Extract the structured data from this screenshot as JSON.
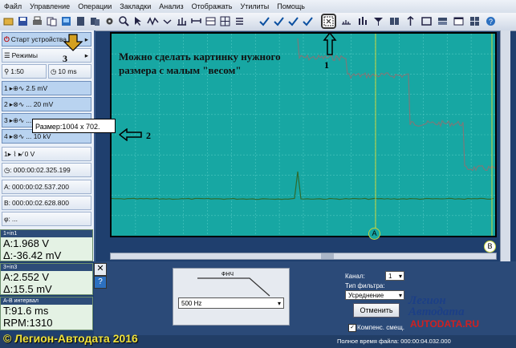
{
  "menu": [
    "Файл",
    "Управление",
    "Операции",
    "Закладки",
    "Анализ",
    "Отображать",
    "Утилиты",
    "Помощь"
  ],
  "left_panel": {
    "start_label": "Старт устройства",
    "modes_label": "Режимы",
    "timebase": "1:50",
    "time_per_div": "10 ms",
    "channels": [
      {
        "num": "1",
        "scale": "2.5 mV"
      },
      {
        "num": "2",
        "scale": "... 20 mV"
      },
      {
        "num": "3",
        "scale": "..."
      },
      {
        "num": "4",
        "scale": "... 10 kV"
      }
    ],
    "trigger": "0 V",
    "times": [
      "000:00:02.325.199",
      "000:00:02.537.200",
      "000:00:02.628.800"
    ],
    "row_A": "A:",
    "row_B": "B:",
    "row_phi": "φ:"
  },
  "readouts": [
    {
      "header": "1+in1",
      "lines": [
        "A:1.968 V",
        "Δ:-36.42 mV"
      ]
    },
    {
      "header": "3+in3",
      "lines": [
        "A:2.552 V",
        "Δ:15.5 mV"
      ]
    },
    {
      "header": "A-B интервал",
      "lines": [
        "T:91.6 ms",
        "RPM:1310"
      ]
    }
  ],
  "caption": [
    "Можно сделать картинку нужного",
    "размера с малым \"весом\""
  ],
  "tooltip": "Размер:1004 x 702.",
  "annotations": {
    "n1": "1",
    "n2": "2",
    "n3": "3"
  },
  "cursors": {
    "a": "A",
    "b": "B"
  },
  "filter": {
    "shape": "ФНЧ",
    "freq": "500 Hz"
  },
  "filter_panel": {
    "channel_label": "Канал:",
    "channel_value": "1",
    "type_label": "Тип фильтра:",
    "type_value": "Усреднение",
    "cancel": "Отменить",
    "compens": "Компенс. смещ."
  },
  "status": {
    "full_time": "Полное время файла: 000:00:04.032.000"
  },
  "copyright": "© Легион-Автодата 2016",
  "logo": {
    "line1": "Легион",
    "line2": "Автодата",
    "url": "AUTODATA.RU"
  },
  "colors": {
    "scope_bg": "#17a7a3",
    "trace": "#7a7a7a",
    "trace2": "#2e6b2e",
    "cursor": "#c8d43a"
  }
}
